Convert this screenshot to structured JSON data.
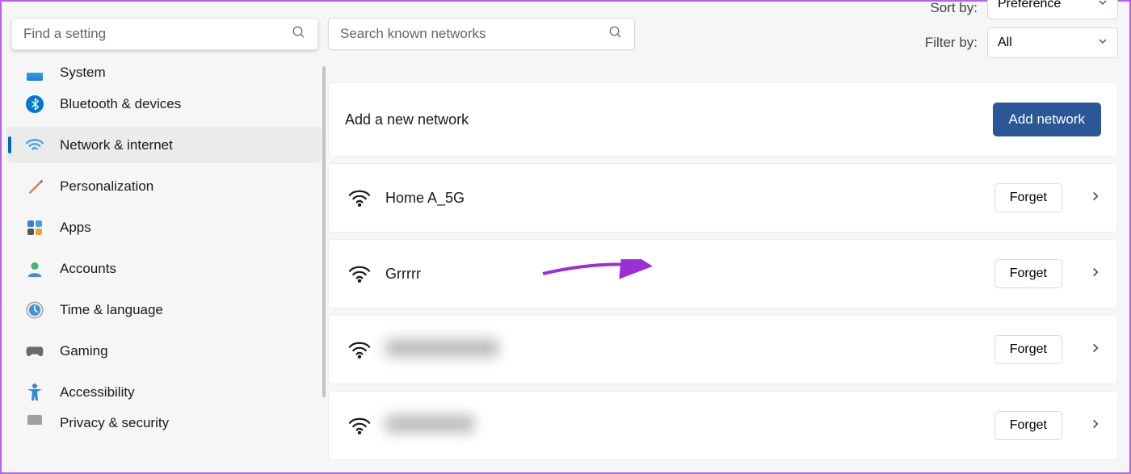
{
  "sidebar": {
    "search_placeholder": "Find a setting",
    "items": [
      {
        "label": "System"
      },
      {
        "label": "Bluetooth & devices"
      },
      {
        "label": "Network & internet"
      },
      {
        "label": "Personalization"
      },
      {
        "label": "Apps"
      },
      {
        "label": "Accounts"
      },
      {
        "label": "Time & language"
      },
      {
        "label": "Gaming"
      },
      {
        "label": "Accessibility"
      },
      {
        "label": "Privacy & security"
      }
    ]
  },
  "main": {
    "search_placeholder": "Search known networks",
    "sort_label": "Sort by:",
    "sort_value": "Preference",
    "filter_label": "Filter by:",
    "filter_value": "All",
    "add_new_label": "Add a new network",
    "add_button": "Add network"
  },
  "networks": [
    {
      "name": "Home A_5G",
      "forget": "Forget",
      "blurred": false
    },
    {
      "name": "Grrrrr",
      "forget": "Forget",
      "blurred": false
    },
    {
      "name": "██████████",
      "forget": "Forget",
      "blurred": true
    },
    {
      "name": "████████",
      "forget": "Forget",
      "blurred": true
    }
  ]
}
